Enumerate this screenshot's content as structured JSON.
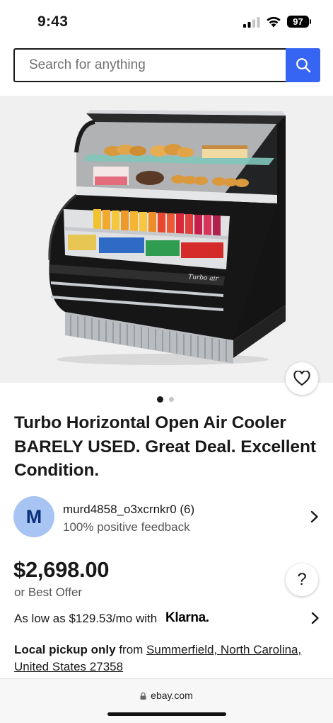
{
  "status_bar": {
    "time": "9:43",
    "battery": "97"
  },
  "search": {
    "placeholder": "Search for anything"
  },
  "gallery": {
    "active_index": 0,
    "total": 2
  },
  "listing": {
    "title": "Turbo Horizontal Open Air Cooler BARELY USED. Great Deal. Excellent Condition.",
    "price": "$2,698.00",
    "best_offer": "or Best Offer"
  },
  "seller": {
    "initial": "M",
    "name": "murd4858_o3xcrnkr0 (6)",
    "feedback": "100% positive feedback"
  },
  "financing": {
    "text": "As low as $129.53/mo with",
    "provider": "Klarna."
  },
  "pickup": {
    "label": "Local pickup only",
    "connector": " from ",
    "location": "Summerfield, North Carolina, United States 27358"
  },
  "browser": {
    "url": "ebay.com"
  },
  "help": {
    "label": "?"
  },
  "product_image": {
    "brand_mark": "Turbo air"
  },
  "colors": {
    "accent": "#3665f3",
    "avatar": "#a8c4f3",
    "text": "#191919"
  }
}
